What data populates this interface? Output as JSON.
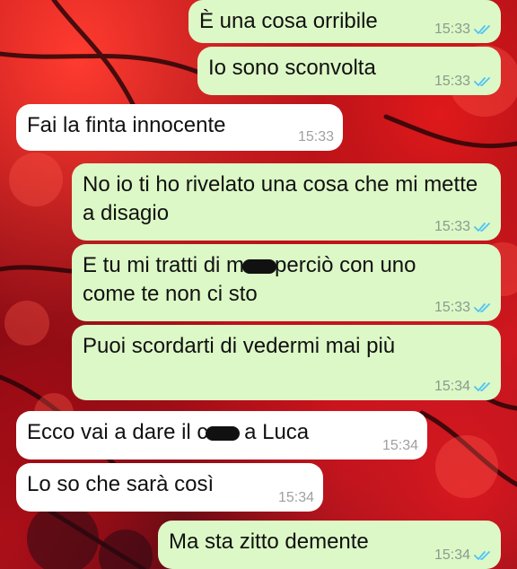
{
  "chat": {
    "messages": [
      {
        "dir": "out",
        "text": "È una cosa orribile",
        "time": "15:33",
        "status": "read"
      },
      {
        "dir": "out",
        "text": "Io sono sconvolta",
        "time": "15:33",
        "status": "read"
      },
      {
        "dir": "in",
        "text": "Fai la finta innocente",
        "time": "15:33"
      },
      {
        "dir": "out",
        "text": "No io ti ho rivelato una cosa che mi mette a disagio",
        "time": "15:33",
        "status": "read"
      },
      {
        "dir": "out",
        "text_before": "E tu mi tratti di m",
        "text_after": "perciò con uno come te non ci sto",
        "time": "15:33",
        "status": "read",
        "redacted": true
      },
      {
        "dir": "out",
        "text": "Puoi scordarti di vedermi mai più",
        "time": "15:34",
        "status": "read"
      },
      {
        "dir": "in",
        "text_before": "Ecco vai a dare il c",
        "text_after": " a Luca",
        "time": "15:34",
        "redacted": true
      },
      {
        "dir": "in",
        "text": "Lo so che sarà così",
        "time": "15:34"
      },
      {
        "dir": "out",
        "text": "Ma sta zitto demente",
        "time": "15:34",
        "status": "read"
      }
    ]
  },
  "colors": {
    "outgoing_bubble": "#dcf8c6",
    "incoming_bubble": "#ffffff",
    "read_ticks": "#4fc3f7",
    "wallpaper": "#c8101a"
  },
  "icons": {
    "read_status": "double-check-icon",
    "redaction": "redaction-mark"
  }
}
